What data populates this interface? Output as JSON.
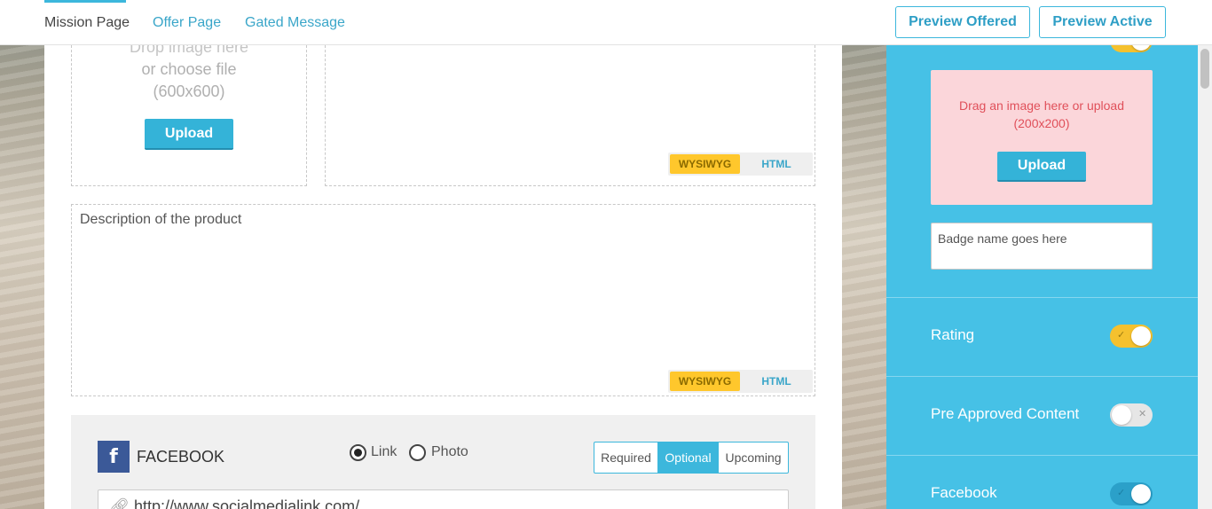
{
  "tabs": [
    {
      "label": "Mission Page"
    },
    {
      "label": "Offer Page"
    },
    {
      "label": "Gated Message"
    }
  ],
  "header": {
    "preview_offered": "Preview Offered",
    "preview_active": "Preview Active"
  },
  "product_image": {
    "line1": "Drop image here",
    "line2": "or choose file",
    "line3": "(600x600)",
    "upload_label": "Upload"
  },
  "editor_top": {
    "wysiwyg": "WYSIWYG",
    "html": "HTML"
  },
  "description": {
    "text": "Description of the product",
    "wysiwyg": "WYSIWYG",
    "html": "HTML"
  },
  "social": {
    "icon_letter": "f",
    "title": "FACEBOOK",
    "radio_link": "Link",
    "radio_photo": "Photo",
    "selected_radio": "Link",
    "segments": [
      "Required",
      "Optional",
      "Upcoming"
    ],
    "selected_segment": "Optional",
    "url_value": "http://www.socialmedialink.com/"
  },
  "sidebar": {
    "badge": {
      "drop_line1": "Drag an image here or upload",
      "drop_line2": "(200x200)",
      "upload_label": "Upload",
      "name_placeholder": "Badge name goes here",
      "toggle_on": true
    },
    "rating": {
      "label": "Rating",
      "on": true
    },
    "pre_approved": {
      "label": "Pre Approved Content",
      "on": false
    },
    "facebook": {
      "label": "Facebook",
      "on": true
    }
  },
  "colors": {
    "accent": "#46c1e6",
    "toggle_yellow": "#f5c12e",
    "wysiwyg": "#ffc72c",
    "badge_bg": "#fbd6da",
    "facebook_blue": "#3b5998"
  }
}
